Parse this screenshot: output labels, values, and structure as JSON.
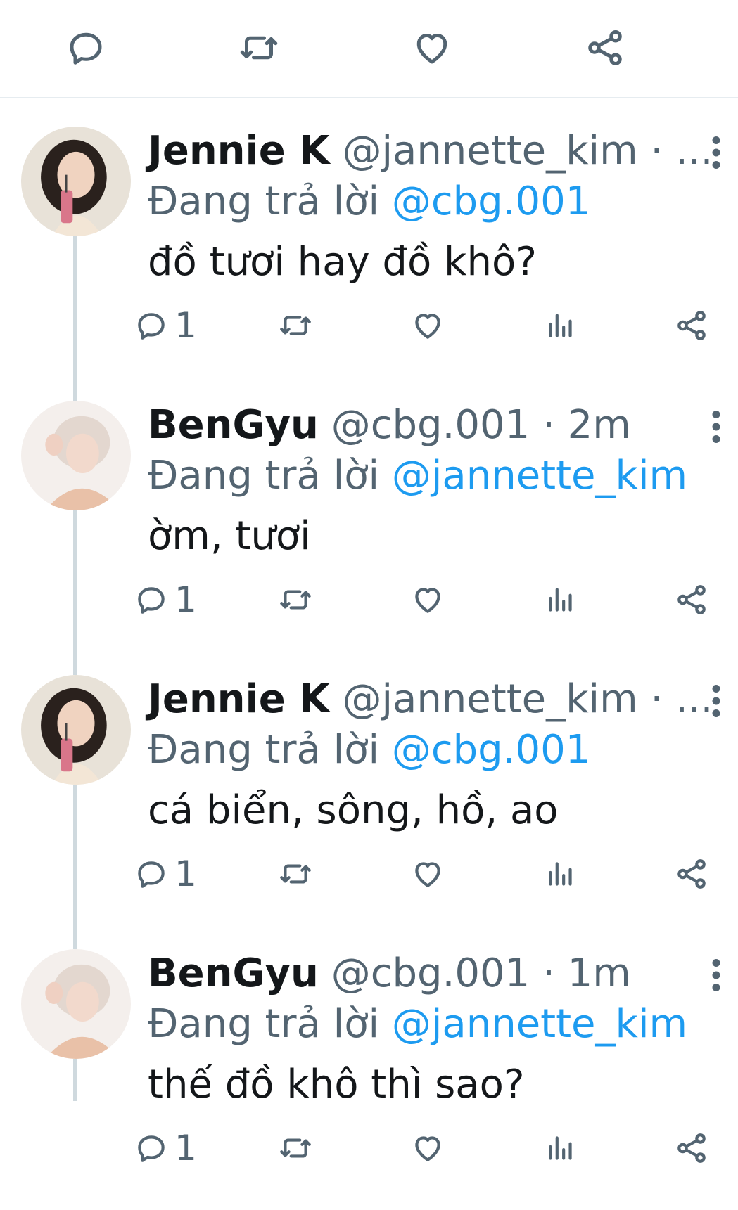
{
  "top_actions": [
    {
      "icon": "comment-icon"
    },
    {
      "icon": "retweet-icon"
    },
    {
      "icon": "heart-icon"
    },
    {
      "icon": "share-icon"
    }
  ],
  "colors": {
    "mention": "#1d9bf0",
    "muted": "#536471",
    "text": "#14171a",
    "thread": "#cfd9de"
  },
  "tweets": [
    {
      "name": "Jennie K",
      "handle": "@jannette_kim",
      "sep": " · ",
      "time": "...",
      "reply_prefix": "Đang trả lời ",
      "reply_to": "@cbg.001",
      "text": "đồ tươi hay đồ khô?",
      "reply_count": "1",
      "avatar": "jennie-avatar"
    },
    {
      "name": "BenGyu",
      "handle": "@cbg.001",
      "sep": " · ",
      "time": "2m",
      "reply_prefix": "Đang trả lời ",
      "reply_to": "@jannette_kim",
      "text": "ờm, tươi",
      "reply_count": "1",
      "avatar": "bengyu-avatar"
    },
    {
      "name": "Jennie K",
      "handle": "@jannette_kim",
      "sep": " · ",
      "time": "...",
      "reply_prefix": "Đang trả lời ",
      "reply_to": "@cbg.001",
      "text": "cá biển, sông, hồ, ao",
      "reply_count": "1",
      "avatar": "jennie-avatar"
    },
    {
      "name": "BenGyu",
      "handle": "@cbg.001",
      "sep": " · ",
      "time": "1m",
      "reply_prefix": "Đang trả lời ",
      "reply_to": "@jannette_kim",
      "text": "thế đồ khô thì sao?",
      "reply_count": "1",
      "avatar": "bengyu-avatar"
    }
  ]
}
